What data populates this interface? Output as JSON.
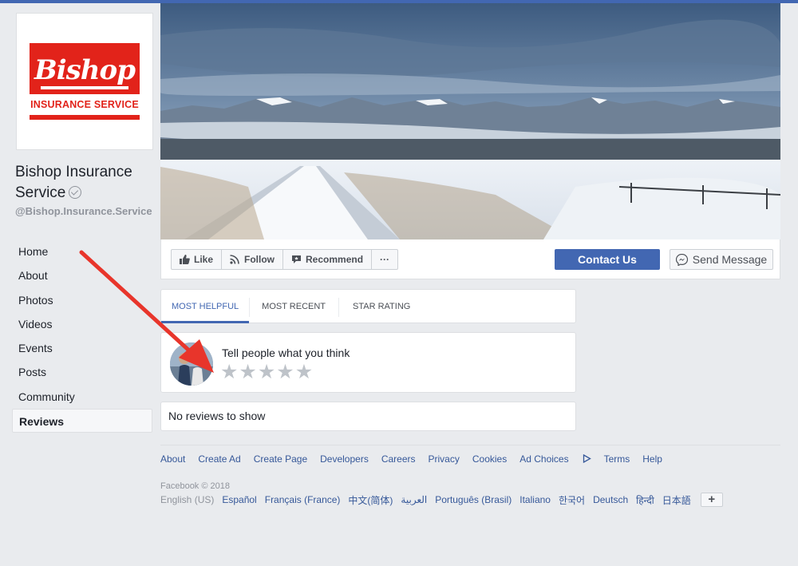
{
  "page": {
    "name": "Bishop Insurance Service",
    "handle": "@Bishop.Insurance.Service",
    "logo_word": "Bishop",
    "logo_sub": "INSURANCE SERVICE"
  },
  "nav": {
    "items": [
      {
        "label": "Home"
      },
      {
        "label": "About"
      },
      {
        "label": "Photos"
      },
      {
        "label": "Videos"
      },
      {
        "label": "Events"
      },
      {
        "label": "Posts"
      },
      {
        "label": "Community"
      },
      {
        "label": "Reviews",
        "active": true
      }
    ]
  },
  "actions": {
    "like": "Like",
    "follow": "Follow",
    "recommend": "Recommend",
    "more": "···",
    "contact": "Contact Us",
    "send_message": "Send Message"
  },
  "reviews": {
    "tabs": [
      "MOST HELPFUL",
      "MOST RECENT",
      "STAR RATING"
    ],
    "prompt": "Tell people what you think",
    "stars": "★★★★★",
    "empty": "No reviews to show"
  },
  "footer": {
    "links": [
      "About",
      "Create Ad",
      "Create Page",
      "Developers",
      "Careers",
      "Privacy",
      "Cookies",
      "Ad Choices",
      "Terms",
      "Help"
    ],
    "copyright": "Facebook © 2018",
    "current_language": "English (US)",
    "languages": [
      "Español",
      "Français (France)",
      "中文(简体)",
      "العربية",
      "Português (Brasil)",
      "Italiano",
      "한국어",
      "Deutsch",
      "हिन्दी",
      "日本語"
    ],
    "plus": "+"
  },
  "colors": {
    "brand": "#4267b2",
    "annotation_arrow": "#e8352b",
    "logo_red": "#e2231a"
  }
}
